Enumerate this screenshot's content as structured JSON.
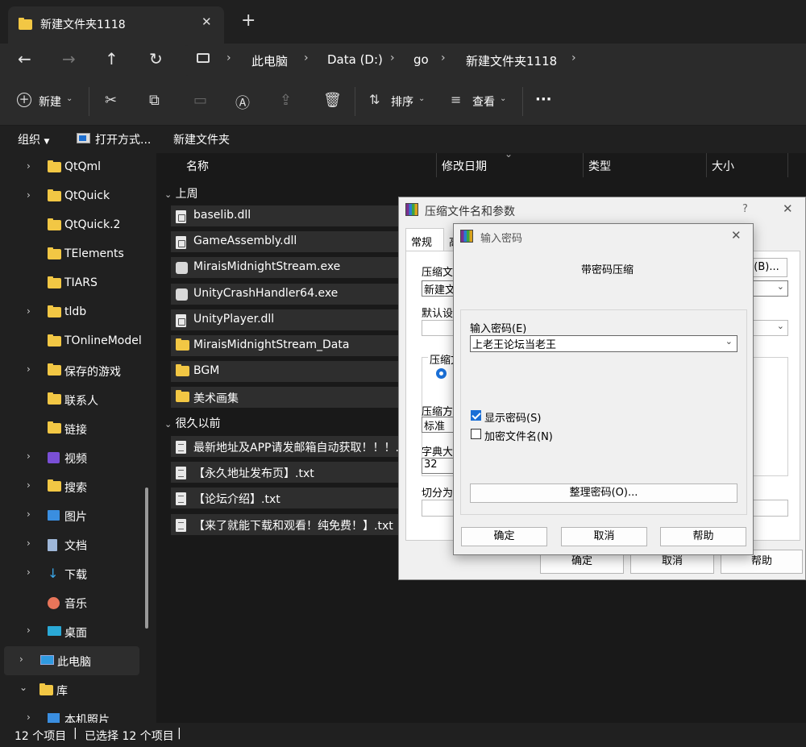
{
  "tab": {
    "title": "新建文件夹1118",
    "close": "✕",
    "add": "+"
  },
  "address": {
    "crumbs": [
      "此电脑",
      "Data (D:)",
      "go",
      "新建文件夹1118"
    ]
  },
  "toolbar": {
    "new_label": "新建",
    "sort_label": "排序",
    "view_label": "查看",
    "more": "···"
  },
  "menubar": {
    "organize": "组织",
    "open_with": "打开方式...",
    "new_folder": "新建文件夹"
  },
  "sidebar": {
    "items": [
      {
        "label": "QtQml",
        "chev": "›",
        "icon": "folder"
      },
      {
        "label": "QtQuick",
        "chev": "›",
        "icon": "folder"
      },
      {
        "label": "QtQuick.2",
        "chev": "",
        "icon": "folder"
      },
      {
        "label": "TElements",
        "chev": "",
        "icon": "folder"
      },
      {
        "label": "TIARS",
        "chev": "",
        "icon": "folder"
      },
      {
        "label": "tldb",
        "chev": "›",
        "icon": "folder"
      },
      {
        "label": "TOnlineModel",
        "chev": "",
        "icon": "folder"
      },
      {
        "label": "保存的游戏",
        "chev": "›",
        "icon": "folder"
      },
      {
        "label": "联系人",
        "chev": "",
        "icon": "folder"
      },
      {
        "label": "链接",
        "chev": "",
        "icon": "folder"
      },
      {
        "label": "视频",
        "chev": "›",
        "icon": "video"
      },
      {
        "label": "搜索",
        "chev": "›",
        "icon": "folder"
      },
      {
        "label": "图片",
        "chev": "›",
        "icon": "picture"
      },
      {
        "label": "文档",
        "chev": "›",
        "icon": "document"
      },
      {
        "label": "下载",
        "chev": "›",
        "icon": "download"
      },
      {
        "label": "音乐",
        "chev": "",
        "icon": "music"
      },
      {
        "label": "桌面",
        "chev": "›",
        "icon": "desktop"
      }
    ],
    "this_pc": "此电脑",
    "library": "库",
    "camera_roll": "本机照片"
  },
  "columns": {
    "name": "名称",
    "modified": "修改日期",
    "type": "类型",
    "size": "大小"
  },
  "groups": {
    "last_week": "上周",
    "long_ago": "很久以前"
  },
  "files_last_week": [
    {
      "name": "baselib.dll",
      "icon": "dll"
    },
    {
      "name": "GameAssembly.dll",
      "icon": "dll"
    },
    {
      "name": "MiraisMidnightStream.exe",
      "icon": "exe"
    },
    {
      "name": "UnityCrashHandler64.exe",
      "icon": "exe"
    },
    {
      "name": "UnityPlayer.dll",
      "icon": "dll"
    },
    {
      "name": "MiraisMidnightStream_Data",
      "icon": "folder"
    },
    {
      "name": "BGM",
      "icon": "folder"
    },
    {
      "name": "美术画集",
      "icon": "folder"
    }
  ],
  "files_long_ago": [
    {
      "name": "最新地址及APP请发邮箱自动获取！！！.txt",
      "icon": "txt"
    },
    {
      "name": "【永久地址发布页】.txt",
      "icon": "txt"
    },
    {
      "name": "【论坛介绍】.txt",
      "icon": "txt"
    },
    {
      "name": "【来了就能下载和观看！纯免费！】.txt",
      "icon": "txt"
    }
  ],
  "status": {
    "count": "12 个项目",
    "selected": "已选择 12 个项目"
  },
  "archive_dialog": {
    "title": "压缩文件名和参数",
    "help": "?",
    "close": "✕",
    "tab_general": "常规",
    "tab_advanced": "高",
    "browse": "(B)...",
    "archive_name_label": "压缩文",
    "archive_name_value": "新建文",
    "default_label": "默认设",
    "format_label": "压缩文",
    "method_label": "压缩方",
    "method_value": "标准",
    "dict_label": "字典大",
    "dict_value": "32",
    "split_label": "切分为",
    "ok": "确定",
    "cancel": "取消",
    "help_btn": "帮助"
  },
  "password_dialog": {
    "title": "输入密码",
    "close": "✕",
    "heading": "带密码压缩",
    "password_label": "输入密码(E)",
    "password_value": "上老王论坛当老王",
    "show_password": "显示密码(S)",
    "encrypt_names": "加密文件名(N)",
    "organize": "整理密码(O)...",
    "ok": "确定",
    "cancel": "取消",
    "help": "帮助"
  }
}
